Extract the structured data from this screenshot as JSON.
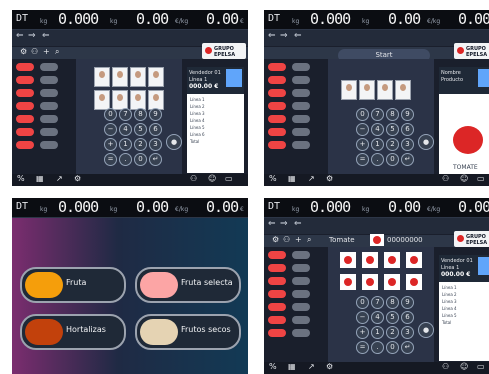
{
  "scale": {
    "dt": "DT",
    "weight": "0.000",
    "kg": "kg",
    "price": "0.00",
    "price_unit": "€/kg",
    "total": "0.00",
    "currency": "€"
  },
  "brand": "GRUPO EPELSA",
  "screen1": {
    "seller": "Vendedor 01",
    "line": "Línea 1",
    "amount": "000.00 €",
    "lines": [
      "Línea 1",
      "Línea 2",
      "Línea 3",
      "Línea 4",
      "Línea 5",
      "Línea 6",
      "Total"
    ]
  },
  "screen2": {
    "start": "Start",
    "seller": "Nombre",
    "sub": "Producto",
    "label": "TOMATE"
  },
  "screen3": {
    "cats": [
      "Fruta",
      "Fruta selecta",
      "Hortalizas",
      "Frutos secos"
    ]
  },
  "screen4": {
    "product": "Tomate",
    "code": "00000000",
    "seller": "Vendedor 01",
    "line": "Línea 1",
    "amount": "000.00 €",
    "lines": [
      "Línea 1",
      "Línea 2",
      "Línea 3",
      "Línea 4",
      "Línea 5",
      "Total"
    ]
  }
}
